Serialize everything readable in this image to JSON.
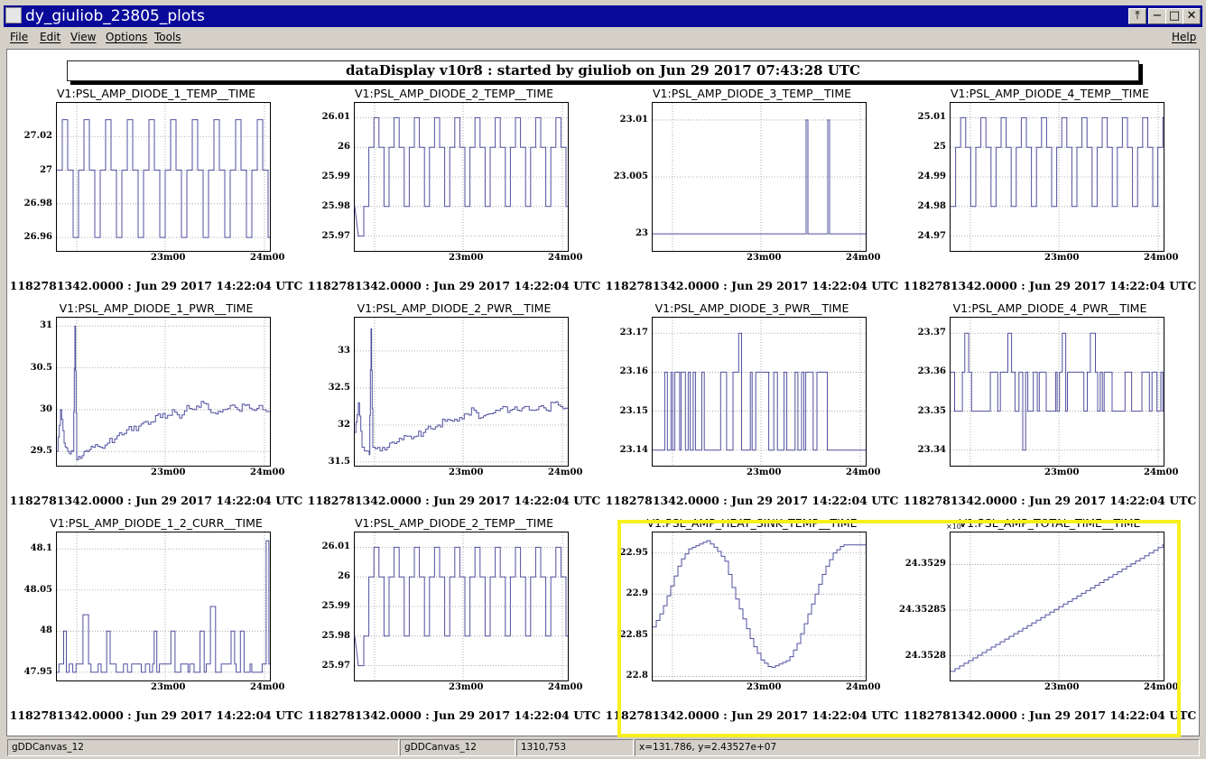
{
  "window": {
    "title": "dy_giuliob_23805_plots",
    "buttons": {
      "pin": "⤒",
      "minimize": "−",
      "maximize": "□",
      "close": "✕"
    }
  },
  "menu": {
    "file": "File",
    "edit": "Edit",
    "view": "View",
    "options": "Options",
    "tools": "Tools",
    "help": "Help"
  },
  "banner": "dataDisplay v10r8 : started by giuliob on Jun 29 2017 07:43:28 UTC",
  "colors": {
    "trace": "#5050a0",
    "highlight": "#f7f01c",
    "titlebar": "#0a0a9a"
  },
  "chart_data": [
    {
      "type": "line",
      "title": "V1:PSL_AMP_DIODE_1_TEMP__TIME",
      "timestamp": "1182781342.0000 : Jun 29 2017 14:22:04 UTC",
      "x_ticks": [
        "23m00",
        "24m00"
      ],
      "xlim": [
        0,
        118
      ],
      "ylim": [
        26.952,
        27.04
      ],
      "y_ticks": [
        {
          "v": 27.02,
          "label": "27.02"
        },
        {
          "v": 27,
          "label": "27"
        },
        {
          "v": 26.98,
          "label": "26.98"
        },
        {
          "v": 26.96,
          "label": "26.96"
        }
      ],
      "pattern": "cycle",
      "cycle": [
        27.0,
        27.03,
        27.0,
        26.96
      ],
      "seg_len": 3
    },
    {
      "type": "line",
      "title": "V1:PSL_AMP_DIODE_2_TEMP__TIME",
      "timestamp": "1182781342.0000 : Jun 29 2017 14:22:04 UTC",
      "x_ticks": [
        "23m00",
        "24m00"
      ],
      "xlim": [
        0,
        118
      ],
      "ylim": [
        25.965,
        26.015
      ],
      "y_ticks": [
        {
          "v": 26.01,
          "label": "26.01"
        },
        {
          "v": 26,
          "label": "26"
        },
        {
          "v": 25.99,
          "label": "25.99"
        },
        {
          "v": 25.98,
          "label": "25.98"
        },
        {
          "v": 25.97,
          "label": "25.97"
        }
      ],
      "pattern": "cycle",
      "cycle": [
        25.98,
        26.0,
        26.01,
        26.0
      ],
      "seg_len": 2.8,
      "points": [
        [
          0,
          25.98
        ],
        [
          2,
          25.97
        ],
        [
          5,
          25.97
        ],
        [
          5,
          25.98
        ]
      ]
    },
    {
      "type": "line",
      "title": "V1:PSL_AMP_DIODE_3_TEMP__TIME",
      "timestamp": "1182781342.0000 : Jun 29 2017 14:22:04 UTC",
      "x_ticks": [
        "23m00",
        "24m00"
      ],
      "xlim": [
        0,
        118
      ],
      "ylim": [
        22.9985,
        23.0115
      ],
      "y_ticks": [
        {
          "v": 23.01,
          "label": "23.01"
        },
        {
          "v": 23.005,
          "label": "23.005"
        },
        {
          "v": 23,
          "label": "23"
        }
      ],
      "pattern": "points",
      "points": [
        [
          0,
          23
        ],
        [
          85,
          23
        ],
        [
          85,
          23.01
        ],
        [
          86,
          23.01
        ],
        [
          86,
          23
        ],
        [
          97,
          23
        ],
        [
          97,
          23.01
        ],
        [
          98,
          23.01
        ],
        [
          98,
          23
        ],
        [
          118,
          23
        ]
      ]
    },
    {
      "type": "line",
      "title": "V1:PSL_AMP_DIODE_4_TEMP__TIME",
      "timestamp": "1182781342.0000 : Jun 29 2017 14:22:04 UTC",
      "x_ticks": [
        "23m00",
        "24m00"
      ],
      "xlim": [
        0,
        118
      ],
      "ylim": [
        24.965,
        25.015
      ],
      "y_ticks": [
        {
          "v": 25.01,
          "label": "25.01"
        },
        {
          "v": 25,
          "label": "25"
        },
        {
          "v": 24.99,
          "label": "24.99"
        },
        {
          "v": 24.98,
          "label": "24.98"
        },
        {
          "v": 24.97,
          "label": "24.97"
        }
      ],
      "pattern": "cycle",
      "cycle": [
        24.98,
        25.0,
        25.01,
        25.0
      ],
      "seg_len": 2.8
    },
    {
      "type": "line",
      "title": "V1:PSL_AMP_DIODE_1_PWR__TIME",
      "timestamp": "1182781342.0000 : Jun 29 2017 14:22:04 UTC",
      "x_ticks": [
        "23m00",
        "24m00"
      ],
      "xlim": [
        0,
        118
      ],
      "ylim": [
        29.33,
        31.1
      ],
      "y_ticks": [
        {
          "v": 31,
          "label": "31"
        },
        {
          "v": 30.5,
          "label": "30.5"
        },
        {
          "v": 30,
          "label": "30"
        },
        {
          "v": 29.5,
          "label": "29.5"
        }
      ],
      "pattern": "points",
      "points": [
        [
          0,
          29.5
        ],
        [
          2,
          30.0
        ],
        [
          4,
          29.6
        ],
        [
          6,
          29.5
        ],
        [
          9,
          29.5
        ],
        [
          10,
          31.0
        ],
        [
          11,
          29.4
        ],
        [
          14,
          29.45
        ],
        [
          17,
          29.5
        ],
        [
          20,
          29.55
        ],
        [
          24,
          29.55
        ],
        [
          28,
          29.6
        ],
        [
          32,
          29.65
        ],
        [
          36,
          29.7
        ],
        [
          40,
          29.8
        ],
        [
          44,
          29.75
        ],
        [
          48,
          29.85
        ],
        [
          52,
          29.85
        ],
        [
          56,
          29.95
        ],
        [
          60,
          29.9
        ],
        [
          64,
          30.0
        ],
        [
          68,
          29.9
        ],
        [
          72,
          30.05
        ],
        [
          76,
          30.0
        ],
        [
          80,
          30.1
        ],
        [
          84,
          30.0
        ],
        [
          88,
          29.95
        ],
        [
          92,
          30.0
        ],
        [
          96,
          30.05
        ],
        [
          100,
          30.0
        ],
        [
          104,
          30.05
        ],
        [
          108,
          30.0
        ],
        [
          112,
          30.05
        ],
        [
          118,
          30.0
        ]
      ],
      "noise": 0.08
    },
    {
      "type": "line",
      "title": "V1:PSL_AMP_DIODE_2_PWR__TIME",
      "timestamp": "1182781342.0000 : Jun 29 2017 14:22:04 UTC",
      "x_ticks": [
        "23m00",
        "24m00"
      ],
      "xlim": [
        0,
        118
      ],
      "ylim": [
        31.45,
        33.45
      ],
      "y_ticks": [
        {
          "v": 33,
          "label": "33"
        },
        {
          "v": 32.5,
          "label": "32.5"
        },
        {
          "v": 32,
          "label": "32"
        },
        {
          "v": 31.5,
          "label": "31.5"
        }
      ],
      "pattern": "points",
      "points": [
        [
          0,
          31.9
        ],
        [
          2,
          32.3
        ],
        [
          4,
          31.7
        ],
        [
          8,
          31.6
        ],
        [
          9,
          33.3
        ],
        [
          10,
          31.7
        ],
        [
          14,
          31.65
        ],
        [
          18,
          31.7
        ],
        [
          22,
          31.75
        ],
        [
          26,
          31.8
        ],
        [
          30,
          31.85
        ],
        [
          34,
          31.85
        ],
        [
          38,
          31.9
        ],
        [
          42,
          31.95
        ],
        [
          46,
          32.0
        ],
        [
          50,
          32.05
        ],
        [
          54,
          32.05
        ],
        [
          58,
          32.1
        ],
        [
          62,
          32.15
        ],
        [
          66,
          32.2
        ],
        [
          70,
          32.1
        ],
        [
          74,
          32.15
        ],
        [
          78,
          32.2
        ],
        [
          82,
          32.25
        ],
        [
          86,
          32.2
        ],
        [
          90,
          32.2
        ],
        [
          94,
          32.25
        ],
        [
          98,
          32.2
        ],
        [
          102,
          32.25
        ],
        [
          106,
          32.2
        ],
        [
          110,
          32.3
        ],
        [
          114,
          32.25
        ],
        [
          118,
          32.25
        ]
      ],
      "noise": 0.1
    },
    {
      "type": "line",
      "title": "V1:PSL_AMP_DIODE_3_PWR__TIME",
      "timestamp": "1182781342.0000 : Jun 29 2017 14:22:04 UTC",
      "x_ticks": [
        "23m00",
        "24m00"
      ],
      "xlim": [
        0,
        118
      ],
      "ylim": [
        23.136,
        23.174
      ],
      "y_ticks": [
        {
          "v": 23.17,
          "label": "23.17"
        },
        {
          "v": 23.16,
          "label": "23.16"
        },
        {
          "v": 23.15,
          "label": "23.15"
        },
        {
          "v": 23.14,
          "label": "23.14"
        }
      ],
      "pattern": "random3",
      "levels": [
        23.14,
        23.16
      ],
      "spike": 23.17,
      "spike_at": [
        48
      ],
      "quiet_from": 90,
      "seed": 7
    },
    {
      "type": "line",
      "title": "V1:PSL_AMP_DIODE_4_PWR__TIME",
      "timestamp": "1182781342.0000 : Jun 29 2017 14:22:04 UTC",
      "x_ticks": [
        "23m00",
        "24m00"
      ],
      "xlim": [
        0,
        118
      ],
      "ylim": [
        23.336,
        23.374
      ],
      "y_ticks": [
        {
          "v": 23.37,
          "label": "23.37"
        },
        {
          "v": 23.36,
          "label": "23.36"
        },
        {
          "v": 23.35,
          "label": "23.35"
        },
        {
          "v": 23.34,
          "label": "23.34"
        }
      ],
      "pattern": "random3",
      "levels": [
        23.35,
        23.36
      ],
      "spike": 23.37,
      "spike_at": [
        8,
        32,
        62,
        78
      ],
      "low": 23.34,
      "low_at": [
        40,
        92
      ],
      "seed": 11
    },
    {
      "type": "line",
      "title": "V1:PSL_AMP_DIODE_1_2_CURR__TIME",
      "timestamp": "1182781342.0000 : Jun 29 2017 14:22:04 UTC",
      "x_ticks": [
        "23m00",
        "24m00"
      ],
      "xlim": [
        0,
        118
      ],
      "ylim": [
        47.94,
        48.12
      ],
      "y_ticks": [
        {
          "v": 48.1,
          "label": "48.1"
        },
        {
          "v": 48.05,
          "label": "48.05"
        },
        {
          "v": 48,
          "label": "48"
        },
        {
          "v": 47.95,
          "label": "47.95"
        }
      ],
      "pattern": "random3",
      "levels": [
        47.95,
        47.96
      ],
      "spike": 48.0,
      "spike_at": [
        4,
        16,
        28,
        54,
        64,
        80,
        96,
        102
      ],
      "high_at": [
        [
          15,
          48.02
        ],
        [
          86,
          48.03
        ],
        [
          116,
          48.11
        ]
      ],
      "seed": 3
    },
    {
      "type": "line",
      "title": "V1:PSL_AMP_DIODE_2_TEMP__TIME",
      "timestamp": "1182781342.0000 : Jun 29 2017 14:22:04 UTC",
      "x_ticks": [
        "23m00",
        "24m00"
      ],
      "xlim": [
        0,
        118
      ],
      "ylim": [
        25.965,
        26.015
      ],
      "y_ticks": [
        {
          "v": 26.01,
          "label": "26.01"
        },
        {
          "v": 26,
          "label": "26"
        },
        {
          "v": 25.99,
          "label": "25.99"
        },
        {
          "v": 25.98,
          "label": "25.98"
        },
        {
          "v": 25.97,
          "label": "25.97"
        }
      ],
      "pattern": "cycle",
      "cycle": [
        25.98,
        26.0,
        26.01,
        26.0
      ],
      "seg_len": 2.8,
      "points": [
        [
          0,
          25.98
        ],
        [
          2,
          25.97
        ],
        [
          5,
          25.97
        ],
        [
          5,
          25.98
        ]
      ]
    },
    {
      "type": "line",
      "title": "V1:PSL_AMP_HEAT_SINK_TEMP__TIME",
      "timestamp": "1182781342.0000 : Jun 29 2017 14:22:04 UTC",
      "x_ticks": [
        "23m00",
        "24m00"
      ],
      "xlim": [
        0,
        118
      ],
      "ylim": [
        22.795,
        22.975
      ],
      "y_ticks": [
        {
          "v": 22.95,
          "label": "22.95"
        },
        {
          "v": 22.9,
          "label": "22.9"
        },
        {
          "v": 22.85,
          "label": "22.85"
        },
        {
          "v": 22.8,
          "label": "22.8"
        }
      ],
      "pattern": "points",
      "points": [
        [
          0,
          22.86
        ],
        [
          5,
          22.88
        ],
        [
          10,
          22.91
        ],
        [
          15,
          22.94
        ],
        [
          20,
          22.955
        ],
        [
          25,
          22.96
        ],
        [
          30,
          22.965
        ],
        [
          35,
          22.955
        ],
        [
          40,
          22.94
        ],
        [
          45,
          22.9
        ],
        [
          50,
          22.87
        ],
        [
          55,
          22.84
        ],
        [
          60,
          22.82
        ],
        [
          65,
          22.81
        ],
        [
          70,
          22.815
        ],
        [
          75,
          22.82
        ],
        [
          80,
          22.84
        ],
        [
          85,
          22.87
        ],
        [
          90,
          22.9
        ],
        [
          95,
          22.93
        ],
        [
          100,
          22.95
        ],
        [
          105,
          22.96
        ],
        [
          110,
          22.96
        ],
        [
          118,
          22.96
        ]
      ],
      "step": 2
    },
    {
      "type": "line",
      "title": "V1:PSL_AMP_TOTAL_TIME__TIME",
      "timestamp": "1182781342.0000 : Jun 29 2017 14:22:04 UTC",
      "x_ticks": [
        "23m00",
        "24m00"
      ],
      "xlim": [
        0,
        118
      ],
      "ylim": [
        24.352773,
        24.352935
      ],
      "y_ticks": [
        {
          "v": 24.3529,
          "label": "24.3529"
        },
        {
          "v": 24.35285,
          "label": "24.35285"
        },
        {
          "v": 24.3528,
          "label": "24.3528"
        }
      ],
      "y_exponent": "×10⁶",
      "pattern": "points",
      "points": [
        [
          0,
          24.352783
        ],
        [
          118,
          24.352922
        ]
      ],
      "step": 2.5
    }
  ],
  "status": {
    "object": "gDDCanvas_12",
    "canvas": "gDDCanvas_12",
    "pixel": "1310,753",
    "coords": "x=131.786, y=2.43527e+07"
  }
}
